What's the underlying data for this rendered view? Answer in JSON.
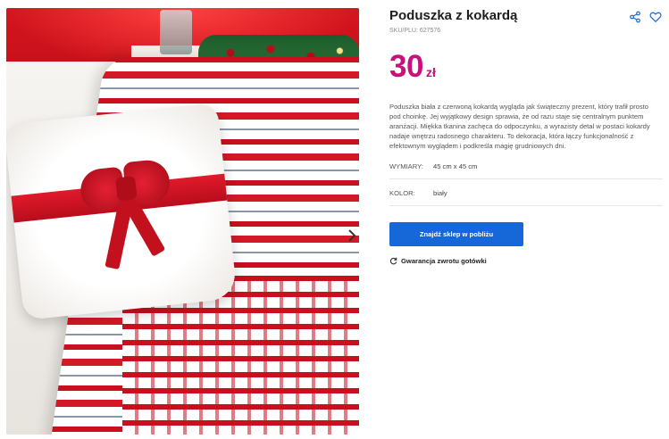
{
  "product": {
    "title": "Poduszka z kokardą",
    "sku": "SKU/PLU: 627576",
    "price_amount": "30",
    "price_currency": "zł",
    "description": "Poduszka biała z czerwoną kokardą wygląda jak świąteczny prezent, który trafił prosto pod choinkę. Jej wyjątkowy design sprawia, że od razu staje się centralnym punktem aranżacji. Miękka tkanina zachęca do odpoczynku, a wyrazisty detal w postaci kokardy nadaje wnętrzu radosnego charakteru. To dekoracja, która łączy funkcjonalność z efektownym wyglądem i podkreśla magię grudniowych dni.",
    "attributes": [
      {
        "label": "WYMIARY:",
        "value": "45 cm x 45 cm"
      },
      {
        "label": "KOLOR:",
        "value": "biały"
      }
    ]
  },
  "actions": {
    "find_store_label": "Znajdź sklep w pobliżu",
    "guarantee_label": "Gwarancja zwrotu gotówki"
  },
  "icons": {
    "share": "share-icon",
    "wishlist": "heart-icon",
    "next": "chevron-right-icon",
    "guarantee": "refresh-icon"
  },
  "colors": {
    "price": "#c8117a",
    "cta_background": "#1668d8",
    "icon_accent": "#1668d8"
  }
}
